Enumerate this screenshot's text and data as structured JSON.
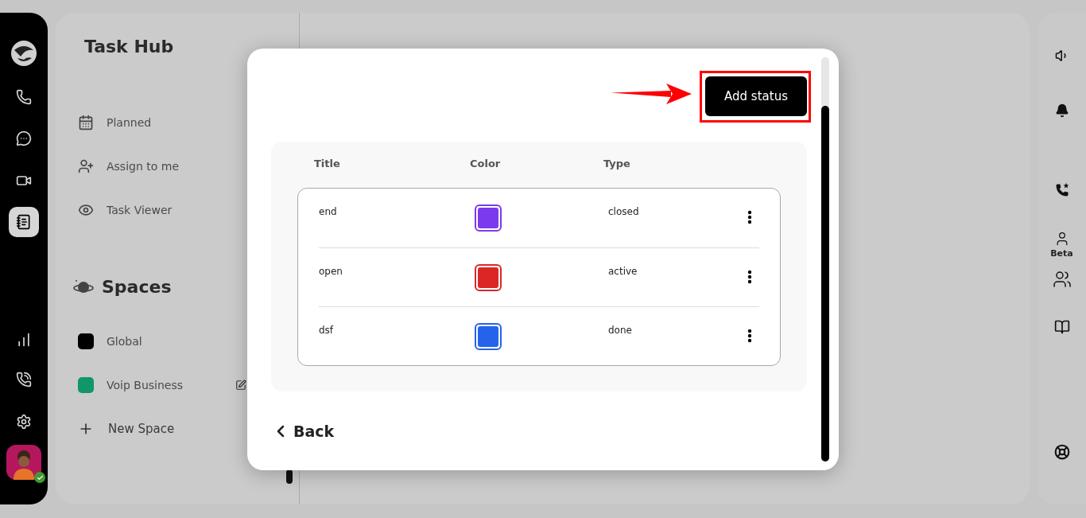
{
  "nav_rail": {
    "items": [
      {
        "selected": false
      },
      {
        "selected": false
      },
      {
        "selected": false
      },
      {
        "selected": false
      },
      {
        "selected": true
      },
      {
        "selected": false
      },
      {
        "selected": false
      },
      {
        "selected": false
      }
    ],
    "avatar": {
      "online": true
    }
  },
  "task_hub": {
    "title": "Task Hub",
    "items": [
      "Planned",
      "Assign to me",
      "Task Viewer"
    ]
  },
  "spaces": {
    "title": "Spaces",
    "items": [
      {
        "name": "Global",
        "color": "#000000"
      },
      {
        "name": "Voip Business",
        "color": "#0f9768"
      }
    ],
    "new_space": "New Space"
  },
  "right_rail": {
    "beta_label": "Beta"
  },
  "status_dialog": {
    "add_button": "Add status",
    "columns": [
      "Title",
      "Color",
      "Type"
    ],
    "rows": [
      {
        "title": "end",
        "color": "#7c3aed",
        "type": "closed"
      },
      {
        "title": "open",
        "color": "#dc2626",
        "type": "active"
      },
      {
        "title": "dsf",
        "color": "#2563eb",
        "type": "done"
      }
    ],
    "back": "Back"
  }
}
